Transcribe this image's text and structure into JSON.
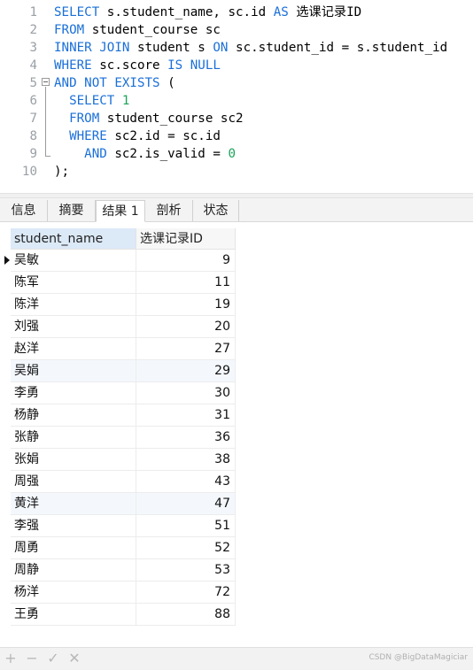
{
  "editor": {
    "line_numbers": [
      "1",
      "2",
      "3",
      "4",
      "5",
      "6",
      "7",
      "8",
      "9",
      "10"
    ],
    "lines": [
      [
        {
          "t": "SELECT",
          "k": "kw"
        },
        {
          "t": " s.student_name, sc.id "
        },
        {
          "t": "AS",
          "k": "kw"
        },
        {
          "t": " 选课记录ID"
        }
      ],
      [
        {
          "t": "FROM",
          "k": "kw"
        },
        {
          "t": " student_course sc"
        }
      ],
      [
        {
          "t": "INNER JOIN",
          "k": "kw"
        },
        {
          "t": " student s "
        },
        {
          "t": "ON",
          "k": "kw"
        },
        {
          "t": " sc.student_id = s.student_id"
        }
      ],
      [
        {
          "t": "WHERE",
          "k": "kw"
        },
        {
          "t": " sc.score "
        },
        {
          "t": "IS NULL",
          "k": "kw"
        }
      ],
      [
        {
          "t": "AND NOT EXISTS",
          "k": "kw"
        },
        {
          "t": " ("
        }
      ],
      [
        {
          "t": "  "
        },
        {
          "t": "SELECT",
          "k": "kw"
        },
        {
          "t": " "
        },
        {
          "t": "1",
          "k": "num"
        }
      ],
      [
        {
          "t": "  "
        },
        {
          "t": "FROM",
          "k": "kw"
        },
        {
          "t": " student_course sc2"
        }
      ],
      [
        {
          "t": "  "
        },
        {
          "t": "WHERE",
          "k": "kw"
        },
        {
          "t": " sc2.id = sc.id"
        }
      ],
      [
        {
          "t": "    "
        },
        {
          "t": "AND",
          "k": "kw"
        },
        {
          "t": " sc2.is_valid = "
        },
        {
          "t": "0",
          "k": "num"
        }
      ],
      [
        {
          "t": ");"
        }
      ]
    ]
  },
  "tabs": [
    {
      "label": "信息",
      "active": false
    },
    {
      "label": "摘要",
      "active": false
    },
    {
      "label": "结果 1",
      "active": true
    },
    {
      "label": "剖析",
      "active": false
    },
    {
      "label": "状态",
      "active": false
    }
  ],
  "results": {
    "columns": [
      "student_name",
      "选课记录ID"
    ],
    "rows": [
      [
        "吴敏",
        "9"
      ],
      [
        "陈军",
        "11"
      ],
      [
        "陈洋",
        "19"
      ],
      [
        "刘强",
        "20"
      ],
      [
        "赵洋",
        "27"
      ],
      [
        "吴娟",
        "29"
      ],
      [
        "李勇",
        "30"
      ],
      [
        "杨静",
        "31"
      ],
      [
        "张静",
        "36"
      ],
      [
        "张娟",
        "38"
      ],
      [
        "周强",
        "43"
      ],
      [
        "黄洋",
        "47"
      ],
      [
        "李强",
        "51"
      ],
      [
        "周勇",
        "52"
      ],
      [
        "周静",
        "53"
      ],
      [
        "杨洋",
        "72"
      ],
      [
        "王勇",
        "88"
      ]
    ],
    "current_row": 0,
    "highlighted_rows": [
      5,
      11
    ]
  },
  "bottom_bar": {
    "add": "+",
    "remove": "−",
    "apply": "✓",
    "discard": "✕"
  },
  "watermark": "CSDN @BigDataMagiciar"
}
